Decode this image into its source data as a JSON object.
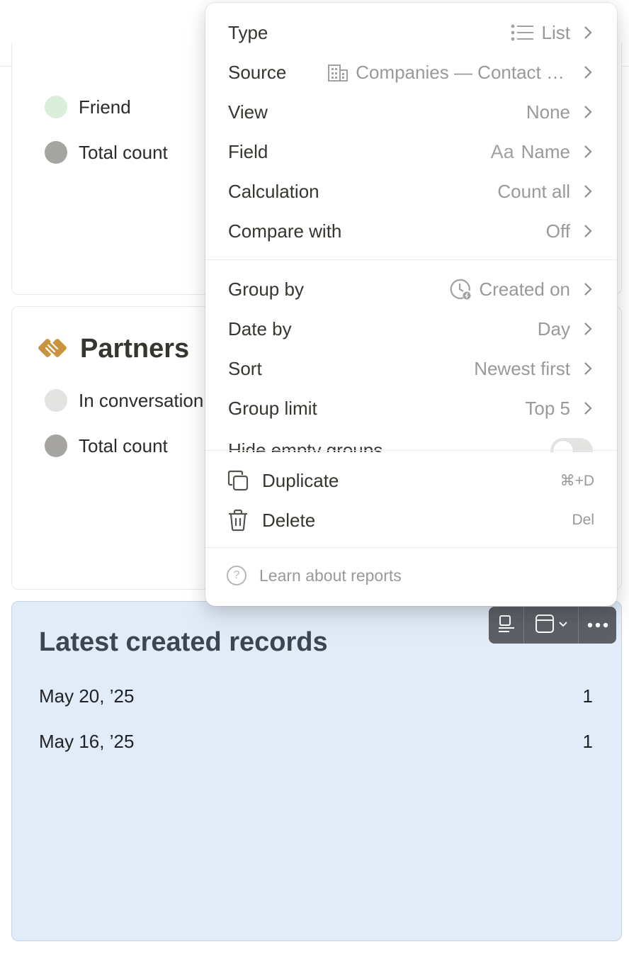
{
  "colors": {
    "friend_dot": "#dbeddb",
    "total_dot": "#a5a4a1",
    "in_conversation_dot": "#e3e3e1",
    "partners_icon": "#c8943e",
    "selected_card_bg": "#e2ebf8",
    "toolbar_bg": "#5d6167"
  },
  "card1": {
    "legend": [
      {
        "label": "Friend",
        "icon": "friend-dot"
      },
      {
        "label": "Total count",
        "icon": "total-dot"
      }
    ]
  },
  "card2": {
    "title": "Partners",
    "icon": "handshake-icon",
    "legend": [
      {
        "label": "In conversation",
        "icon": "in-conversation-dot"
      },
      {
        "label": "Total count",
        "icon": "total-dot"
      }
    ]
  },
  "card3": {
    "title": "Latest created records",
    "rows": [
      {
        "date": "May 20, ’25",
        "count": "1"
      },
      {
        "date": "May 16, ’25",
        "count": "1"
      }
    ]
  },
  "toolbar": {
    "buttons": [
      "caption-icon",
      "layout-icon",
      "more-icon"
    ]
  },
  "menu": {
    "items": [
      {
        "label": "Type",
        "value": "List",
        "icon": "list-icon"
      },
      {
        "label": "Source",
        "value": "Companies — Contact …",
        "icon": "building-icon"
      },
      {
        "label": "View",
        "value": "None"
      },
      {
        "label": "Field",
        "value": "Name",
        "icon": "text-aa-icon"
      },
      {
        "label": "Calculation",
        "value": "Count all"
      },
      {
        "label": "Compare with",
        "value": "Off"
      }
    ],
    "group_items": [
      {
        "label": "Group by",
        "value": "Created on",
        "icon": "clock-icon"
      },
      {
        "label": "Date by",
        "value": "Day"
      },
      {
        "label": "Sort",
        "value": "Newest first"
      },
      {
        "label": "Group limit",
        "value": "Top 5"
      }
    ],
    "hide_empty_label": "Hide empty groups",
    "hide_empty_on": false,
    "actions": [
      {
        "label": "Duplicate",
        "shortcut": "⌘+D",
        "icon": "duplicate-icon"
      },
      {
        "label": "Delete",
        "shortcut": "Del",
        "icon": "trash-icon"
      }
    ],
    "learn_label": "Learn about reports",
    "text_icon_label": "Aa"
  }
}
